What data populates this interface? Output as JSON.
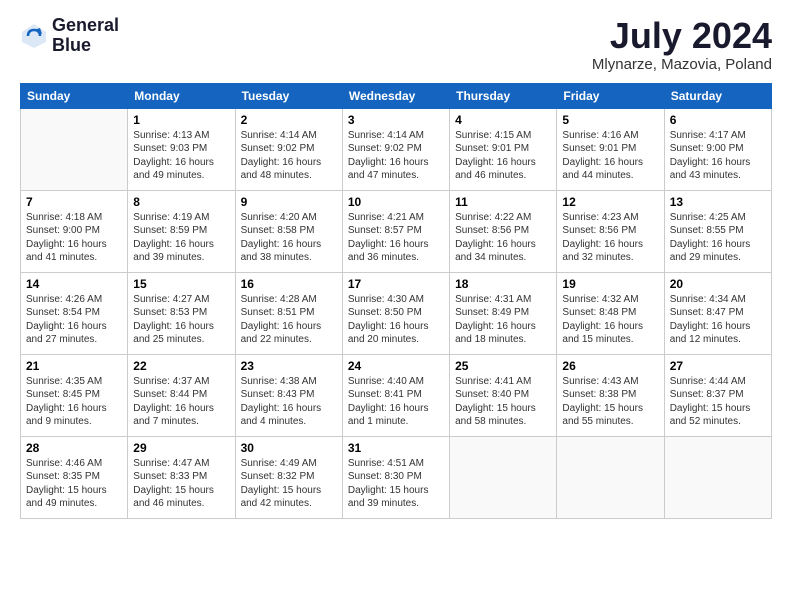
{
  "logo": {
    "line1": "General",
    "line2": "Blue"
  },
  "title": "July 2024",
  "subtitle": "Mlynarze, Mazovia, Poland",
  "days_header": [
    "Sunday",
    "Monday",
    "Tuesday",
    "Wednesday",
    "Thursday",
    "Friday",
    "Saturday"
  ],
  "weeks": [
    [
      {
        "num": "",
        "info": ""
      },
      {
        "num": "1",
        "info": "Sunrise: 4:13 AM\nSunset: 9:03 PM\nDaylight: 16 hours\nand 49 minutes."
      },
      {
        "num": "2",
        "info": "Sunrise: 4:14 AM\nSunset: 9:02 PM\nDaylight: 16 hours\nand 48 minutes."
      },
      {
        "num": "3",
        "info": "Sunrise: 4:14 AM\nSunset: 9:02 PM\nDaylight: 16 hours\nand 47 minutes."
      },
      {
        "num": "4",
        "info": "Sunrise: 4:15 AM\nSunset: 9:01 PM\nDaylight: 16 hours\nand 46 minutes."
      },
      {
        "num": "5",
        "info": "Sunrise: 4:16 AM\nSunset: 9:01 PM\nDaylight: 16 hours\nand 44 minutes."
      },
      {
        "num": "6",
        "info": "Sunrise: 4:17 AM\nSunset: 9:00 PM\nDaylight: 16 hours\nand 43 minutes."
      }
    ],
    [
      {
        "num": "7",
        "info": "Sunrise: 4:18 AM\nSunset: 9:00 PM\nDaylight: 16 hours\nand 41 minutes."
      },
      {
        "num": "8",
        "info": "Sunrise: 4:19 AM\nSunset: 8:59 PM\nDaylight: 16 hours\nand 39 minutes."
      },
      {
        "num": "9",
        "info": "Sunrise: 4:20 AM\nSunset: 8:58 PM\nDaylight: 16 hours\nand 38 minutes."
      },
      {
        "num": "10",
        "info": "Sunrise: 4:21 AM\nSunset: 8:57 PM\nDaylight: 16 hours\nand 36 minutes."
      },
      {
        "num": "11",
        "info": "Sunrise: 4:22 AM\nSunset: 8:56 PM\nDaylight: 16 hours\nand 34 minutes."
      },
      {
        "num": "12",
        "info": "Sunrise: 4:23 AM\nSunset: 8:56 PM\nDaylight: 16 hours\nand 32 minutes."
      },
      {
        "num": "13",
        "info": "Sunrise: 4:25 AM\nSunset: 8:55 PM\nDaylight: 16 hours\nand 29 minutes."
      }
    ],
    [
      {
        "num": "14",
        "info": "Sunrise: 4:26 AM\nSunset: 8:54 PM\nDaylight: 16 hours\nand 27 minutes."
      },
      {
        "num": "15",
        "info": "Sunrise: 4:27 AM\nSunset: 8:53 PM\nDaylight: 16 hours\nand 25 minutes."
      },
      {
        "num": "16",
        "info": "Sunrise: 4:28 AM\nSunset: 8:51 PM\nDaylight: 16 hours\nand 22 minutes."
      },
      {
        "num": "17",
        "info": "Sunrise: 4:30 AM\nSunset: 8:50 PM\nDaylight: 16 hours\nand 20 minutes."
      },
      {
        "num": "18",
        "info": "Sunrise: 4:31 AM\nSunset: 8:49 PM\nDaylight: 16 hours\nand 18 minutes."
      },
      {
        "num": "19",
        "info": "Sunrise: 4:32 AM\nSunset: 8:48 PM\nDaylight: 16 hours\nand 15 minutes."
      },
      {
        "num": "20",
        "info": "Sunrise: 4:34 AM\nSunset: 8:47 PM\nDaylight: 16 hours\nand 12 minutes."
      }
    ],
    [
      {
        "num": "21",
        "info": "Sunrise: 4:35 AM\nSunset: 8:45 PM\nDaylight: 16 hours\nand 9 minutes."
      },
      {
        "num": "22",
        "info": "Sunrise: 4:37 AM\nSunset: 8:44 PM\nDaylight: 16 hours\nand 7 minutes."
      },
      {
        "num": "23",
        "info": "Sunrise: 4:38 AM\nSunset: 8:43 PM\nDaylight: 16 hours\nand 4 minutes."
      },
      {
        "num": "24",
        "info": "Sunrise: 4:40 AM\nSunset: 8:41 PM\nDaylight: 16 hours\nand 1 minute."
      },
      {
        "num": "25",
        "info": "Sunrise: 4:41 AM\nSunset: 8:40 PM\nDaylight: 15 hours\nand 58 minutes."
      },
      {
        "num": "26",
        "info": "Sunrise: 4:43 AM\nSunset: 8:38 PM\nDaylight: 15 hours\nand 55 minutes."
      },
      {
        "num": "27",
        "info": "Sunrise: 4:44 AM\nSunset: 8:37 PM\nDaylight: 15 hours\nand 52 minutes."
      }
    ],
    [
      {
        "num": "28",
        "info": "Sunrise: 4:46 AM\nSunset: 8:35 PM\nDaylight: 15 hours\nand 49 minutes."
      },
      {
        "num": "29",
        "info": "Sunrise: 4:47 AM\nSunset: 8:33 PM\nDaylight: 15 hours\nand 46 minutes."
      },
      {
        "num": "30",
        "info": "Sunrise: 4:49 AM\nSunset: 8:32 PM\nDaylight: 15 hours\nand 42 minutes."
      },
      {
        "num": "31",
        "info": "Sunrise: 4:51 AM\nSunset: 8:30 PM\nDaylight: 15 hours\nand 39 minutes."
      },
      {
        "num": "",
        "info": ""
      },
      {
        "num": "",
        "info": ""
      },
      {
        "num": "",
        "info": ""
      }
    ]
  ]
}
